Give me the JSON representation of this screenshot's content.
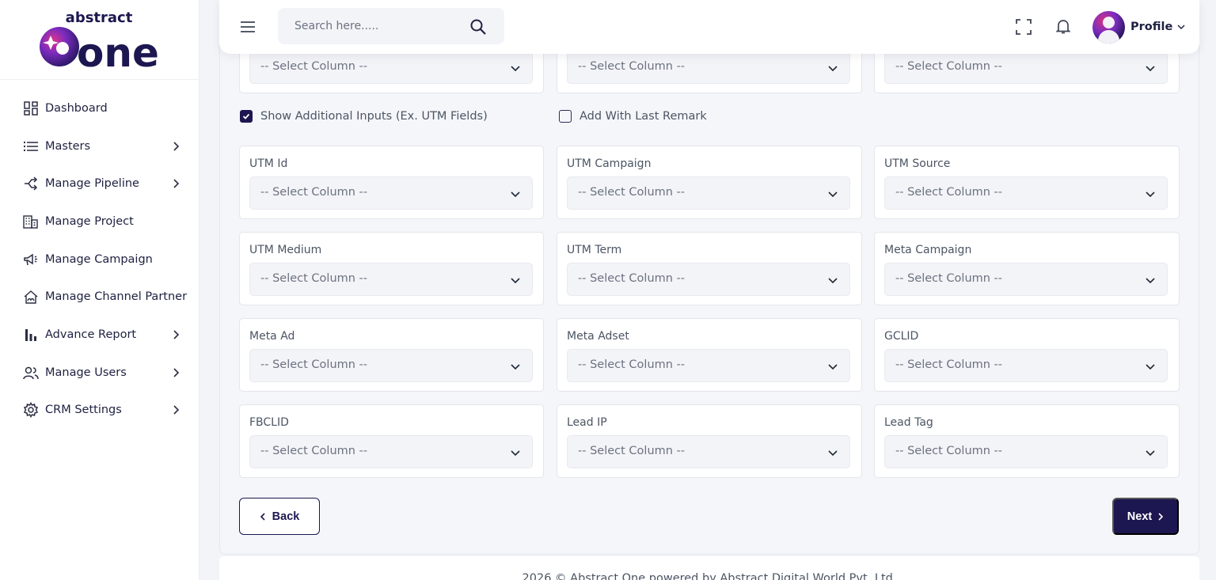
{
  "brand": {
    "top_word": "abstract",
    "main_word": "one"
  },
  "sidebar": {
    "items": [
      {
        "label": "Dashboard",
        "icon": "dashboard-icon",
        "has_submenu": false
      },
      {
        "label": "Masters",
        "icon": "list-icon",
        "has_submenu": true
      },
      {
        "label": "Manage Pipeline",
        "icon": "pipeline-icon",
        "has_submenu": true
      },
      {
        "label": "Manage Project",
        "icon": "building-icon",
        "has_submenu": false
      },
      {
        "label": "Manage Campaign",
        "icon": "megaphone-icon",
        "has_submenu": false
      },
      {
        "label": "Manage Channel Partner",
        "icon": "partner-icon",
        "has_submenu": false
      },
      {
        "label": "Advance Report",
        "icon": "bar-chart-icon",
        "has_submenu": true
      },
      {
        "label": "Manage Users",
        "icon": "users-icon",
        "has_submenu": true
      },
      {
        "label": "CRM Settings",
        "icon": "gear-icon",
        "has_submenu": true
      }
    ]
  },
  "header": {
    "search_placeholder": "Search here.....",
    "profile_label": "Profile"
  },
  "form": {
    "select_placeholder": "-- Select Column --",
    "show_additional_label": "Show Additional Inputs (Ex. UTM Fields)",
    "show_additional_checked": true,
    "add_last_remark_label": "Add With Last Remark",
    "add_last_remark_checked": false,
    "fields": [
      {
        "label": "UTM Id",
        "value": "-- Select Column --"
      },
      {
        "label": "UTM Campaign",
        "value": "-- Select Column --"
      },
      {
        "label": "UTM Source",
        "value": "-- Select Column --"
      },
      {
        "label": "UTM Medium",
        "value": "-- Select Column --"
      },
      {
        "label": "UTM Term",
        "value": "-- Select Column --"
      },
      {
        "label": "Meta Campaign",
        "value": "-- Select Column --"
      },
      {
        "label": "Meta Ad",
        "value": "-- Select Column --"
      },
      {
        "label": "Meta Adset",
        "value": "-- Select Column --"
      },
      {
        "label": "GCLID",
        "value": "-- Select Column --"
      },
      {
        "label": "FBCLID",
        "value": "-- Select Column --"
      },
      {
        "label": "Lead IP",
        "value": "-- Select Column --"
      },
      {
        "label": "Lead Tag",
        "value": "-- Select Column --"
      }
    ],
    "top_row_values": [
      "-- Select Column --",
      "-- Select Column --",
      "-- Select Column --"
    ],
    "back_label": "Back",
    "next_label": "Next"
  },
  "footer": {
    "text": "2026 © Abstract One powered by Abstract Digital World Pvt. Ltd."
  },
  "colors": {
    "primary": "#1c1750",
    "accent_pink": "#d63384",
    "accent_purple": "#7b2cbf"
  }
}
